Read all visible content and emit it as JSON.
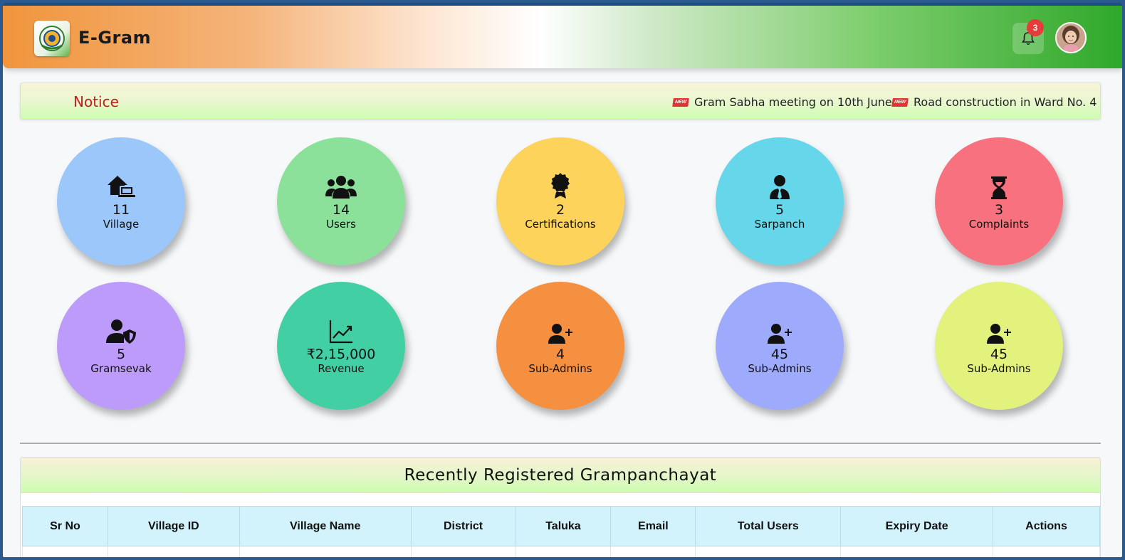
{
  "app": {
    "brand": "E-Gram",
    "notifications_count": "3"
  },
  "notice": {
    "title": "Notice",
    "items": [
      "Gram Sabha meeting on 10th June",
      "Road construction in Ward No. 4"
    ],
    "new_tag": "NEW"
  },
  "stats": [
    {
      "icon": "house-laptop-icon",
      "value": "11",
      "label": "Village",
      "color": "#9cc7fb"
    },
    {
      "icon": "users-icon",
      "value": "14",
      "label": "Users",
      "color": "#8be09a"
    },
    {
      "icon": "certificate-icon",
      "value": "2",
      "label": "Certifications",
      "color": "#fdd35c"
    },
    {
      "icon": "user-tie-icon",
      "value": "5",
      "label": "Sarpanch",
      "color": "#66d7ea"
    },
    {
      "icon": "hourglass-icon",
      "value": "3",
      "label": "Complaints",
      "color": "#f7727e"
    },
    {
      "icon": "user-shield-icon",
      "value": "5",
      "label": "Gramsevak",
      "color": "#bd9bfb"
    },
    {
      "icon": "chart-line-icon",
      "value": "₹2,15,000",
      "label": "Revenue",
      "color": "#42cfa4"
    },
    {
      "icon": "user-plus-icon",
      "value": "4",
      "label": "Sub-Admins",
      "color": "#f59040"
    },
    {
      "icon": "user-plus-icon",
      "value": "45",
      "label": "Sub-Admins",
      "color": "#9eaafc"
    },
    {
      "icon": "user-plus-icon",
      "value": "45",
      "label": "Sub-Admins",
      "color": "#e3f27d"
    }
  ],
  "table": {
    "title": "Recently Registered Grampanchayat",
    "columns": [
      "Sr No",
      "Village ID",
      "Village Name",
      "District",
      "Taluka",
      "Email",
      "Total Users",
      "Expiry Date",
      "Actions"
    ]
  }
}
